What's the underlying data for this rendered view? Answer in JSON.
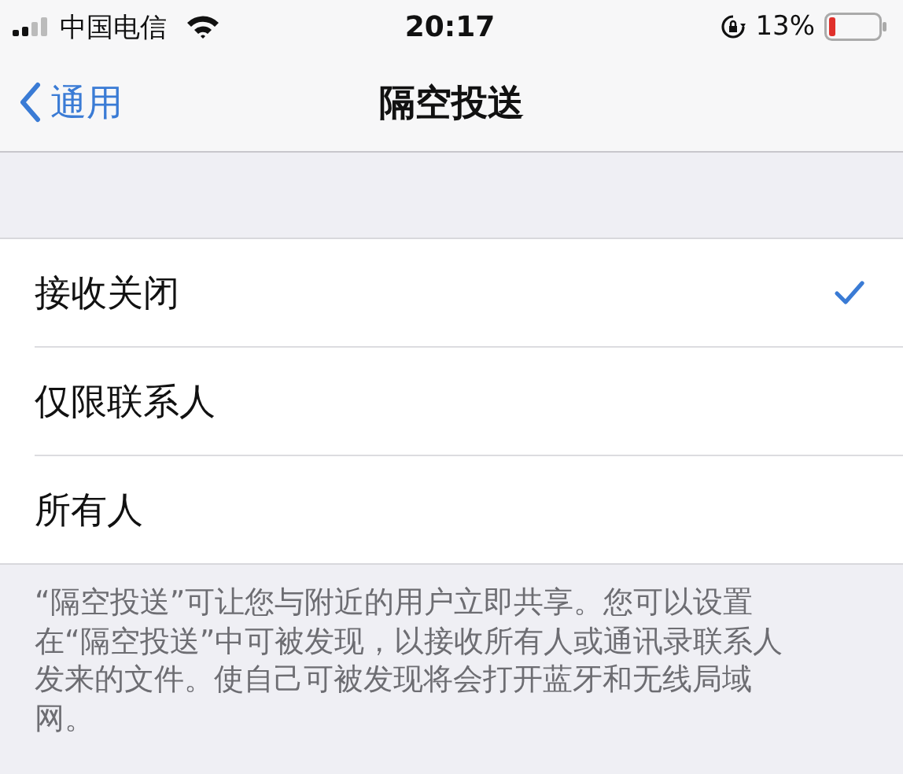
{
  "status_bar": {
    "carrier": "中国电信",
    "time": "20:17",
    "battery_percent": "13%"
  },
  "nav": {
    "back": "通用",
    "title": "隔空投送"
  },
  "options": [
    {
      "label": "接收关闭",
      "selected": true
    },
    {
      "label": "仅限联系人",
      "selected": false
    },
    {
      "label": "所有人",
      "selected": false
    }
  ],
  "footer": "“隔空投送”可让您与附近的用户立即共享。您可以设置在“隔空投送”中可被发现，以接收所有人或通讯录联系人发来的文件。使自己可被发现将会打开蓝牙和无线局域网。"
}
